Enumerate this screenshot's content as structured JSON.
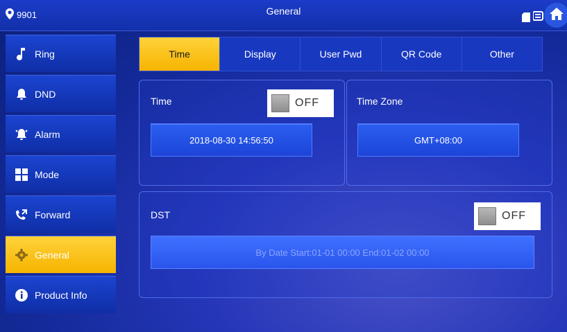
{
  "header": {
    "location": "9901",
    "title": "General"
  },
  "sidebar": {
    "items": [
      {
        "label": "Ring"
      },
      {
        "label": "DND"
      },
      {
        "label": "Alarm"
      },
      {
        "label": "Mode"
      },
      {
        "label": "Forward"
      },
      {
        "label": "General"
      },
      {
        "label": "Product Info"
      }
    ],
    "active_index": 5
  },
  "tabs": [
    {
      "label": "Time"
    },
    {
      "label": "Display"
    },
    {
      "label": "User Pwd"
    },
    {
      "label": "QR Code"
    },
    {
      "label": "Other"
    }
  ],
  "time_panel": {
    "label": "Time",
    "toggle": "OFF",
    "datetime": "2018-08-30 14:56:50"
  },
  "timezone_panel": {
    "label": "Time Zone",
    "value": "GMT+08:00"
  },
  "dst_panel": {
    "label": "DST",
    "toggle": "OFF",
    "value": "By Date Start:01-01 00:00  End:01-02 00:00"
  },
  "colors": {
    "accent": "#f6b400",
    "primary": "#1230aa"
  }
}
